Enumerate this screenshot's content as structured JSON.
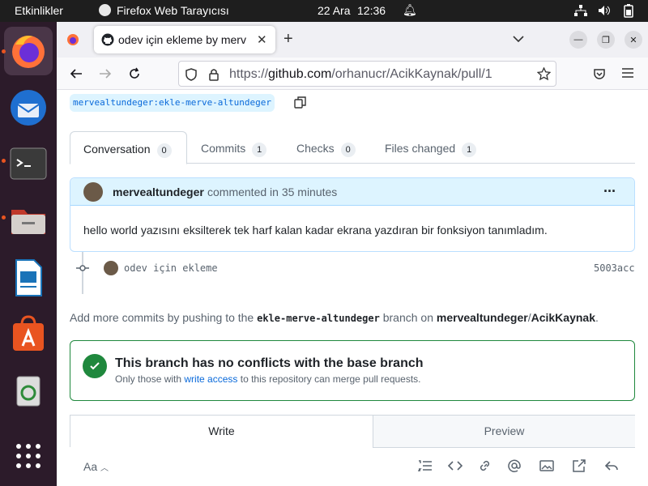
{
  "topbar": {
    "activities": "Etkinlikler",
    "app_name": "Firefox Web Tarayıcısı",
    "date": "22 Ara",
    "time": "12:36"
  },
  "browser": {
    "tab_title": "odev için ekleme by merv",
    "url_prefix": "https://",
    "url_domain": "github.com",
    "url_path": "/orhanucr/AcikKaynak/pull/1"
  },
  "pr": {
    "head_branch": "mervealtundeger:ekle-merve-altundeger",
    "tabs": [
      {
        "label": "Conversation",
        "count": "0"
      },
      {
        "label": "Commits",
        "count": "1"
      },
      {
        "label": "Checks",
        "count": "0"
      },
      {
        "label": "Files changed",
        "count": "1"
      }
    ],
    "comment": {
      "author": "mervealtundeger",
      "meta": "commented in 35 minutes",
      "menu": "···",
      "body": "hello world yazısını eksilterek tek harf kalan kadar ekrana yazdıran bir fonksiyon tanımladım."
    },
    "commit": {
      "message": "odev için ekleme",
      "sha": "5003acc"
    },
    "add_commits": {
      "pre": "Add more commits by pushing to the ",
      "branch": "ekle-merve-altundeger",
      "mid": " branch on ",
      "owner": "mervealtundeger",
      "slash": "/",
      "repo": "AcikKaynak",
      "end": "."
    },
    "merge": {
      "title": "This branch has no conflicts with the base branch",
      "sub_pre": "Only those with ",
      "sub_link": "write access",
      "sub_post": " to this repository can merge pull requests."
    },
    "write_tabs": {
      "write": "Write",
      "preview": "Preview"
    },
    "toolbar": {
      "text_style": "Aa"
    }
  },
  "colors": {
    "accent": "#0969da",
    "success": "#1f883d",
    "ubuntu_orange": "#e95420"
  }
}
